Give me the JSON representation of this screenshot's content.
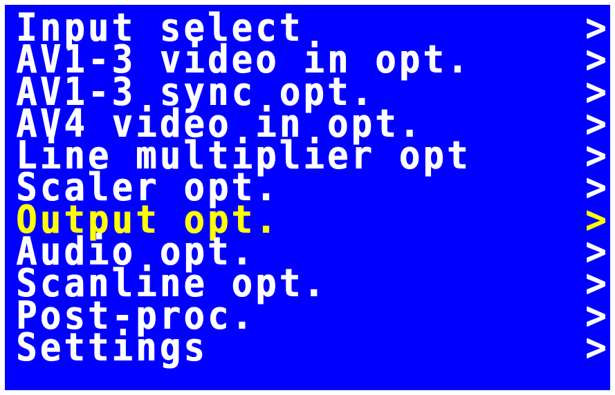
{
  "menu": {
    "selected_index": 6,
    "colors": {
      "background": "#0000ff",
      "text": "#ffffff",
      "selected_text": "#ffff00"
    },
    "items": [
      {
        "label": "Input select",
        "arrow": ">"
      },
      {
        "label": "AV1-3 video in opt.",
        "arrow": ">"
      },
      {
        "label": "AV1-3 sync opt.",
        "arrow": ">"
      },
      {
        "label": "AV4 video in opt.",
        "arrow": ">"
      },
      {
        "label": "Line multiplier opt",
        "arrow": ">"
      },
      {
        "label": "Scaler opt.",
        "arrow": ">"
      },
      {
        "label": "Output opt.",
        "arrow": ">"
      },
      {
        "label": "Audio opt.",
        "arrow": ">"
      },
      {
        "label": "Scanline opt.",
        "arrow": ">"
      },
      {
        "label": "Post-proc.",
        "arrow": ">"
      },
      {
        "label": "Settings",
        "arrow": ">"
      }
    ]
  }
}
